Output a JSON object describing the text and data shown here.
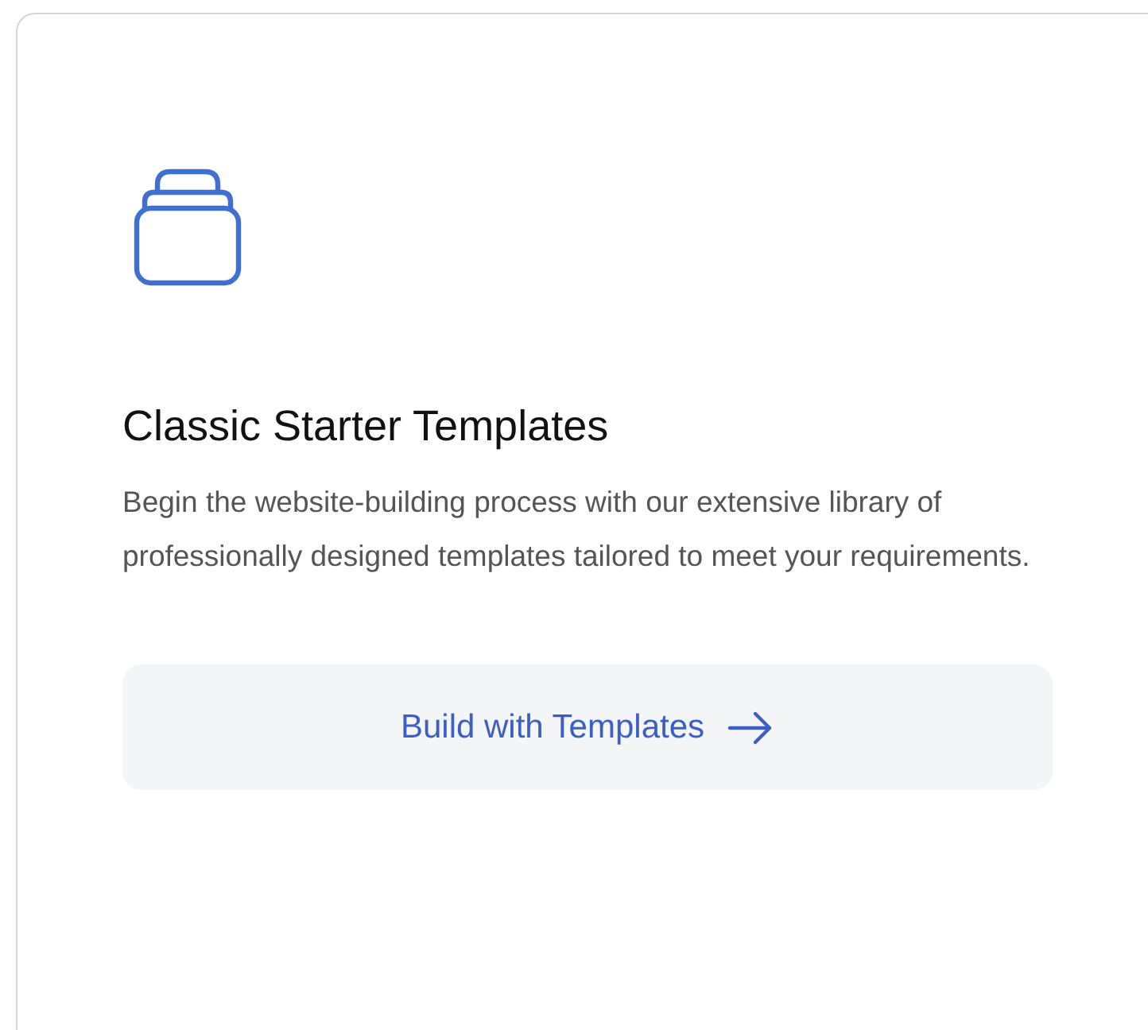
{
  "card": {
    "title": "Classic Starter Templates",
    "description": "Begin the website-building process with our extensive library of professionally designed templates tailored to meet your requirements.",
    "button": {
      "label": "Build with Templates"
    }
  }
}
